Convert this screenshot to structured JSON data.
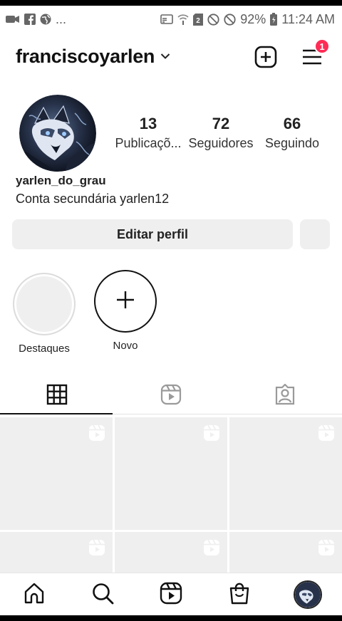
{
  "status_bar": {
    "left_icons": [
      "video-icon",
      "facebook-icon",
      "globe-icon"
    ],
    "overflow": "...",
    "right_icons": [
      "cast-icon",
      "wifi-icon",
      "sim-icon",
      "dnd-icon",
      "block-icon"
    ],
    "battery": "92%",
    "time": "11:24 AM"
  },
  "header": {
    "username": "franciscoyarlen",
    "notification_count": "1"
  },
  "profile": {
    "stats": [
      {
        "value": "13",
        "label": "Publicaçõ..."
      },
      {
        "value": "72",
        "label": "Seguidores"
      },
      {
        "value": "66",
        "label": "Seguindo"
      }
    ],
    "name": "yarlen_do_grau",
    "bio": "Conta secundária yarlen12",
    "edit_label": "Editar perfil"
  },
  "highlights": [
    {
      "label": "Destaques"
    },
    {
      "label": "Novo"
    }
  ],
  "tabs": [
    "grid",
    "reels",
    "tagged"
  ],
  "colors": {
    "badge": "#ff2c55",
    "button_bg": "#efefef",
    "placeholder": "#efefef",
    "text": "#111111"
  }
}
